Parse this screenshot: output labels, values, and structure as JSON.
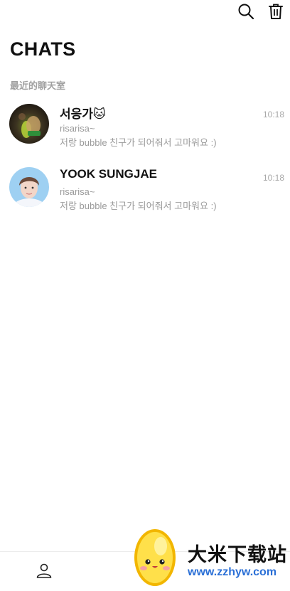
{
  "header": {
    "title": "CHATS",
    "section_label": "最近的聊天室",
    "icons": [
      "search-icon",
      "trash-icon"
    ]
  },
  "chats": [
    {
      "name": "서응가",
      "emoji": "🐱",
      "time": "10:18",
      "sender": "risarisa~",
      "preview": "저랑 bubble 친구가 되어줘서 고마워요 :)"
    },
    {
      "name": "YOOK SUNGJAE",
      "emoji": "",
      "time": "10:18",
      "sender": "risarisa~",
      "preview": "저랑 bubble 친구가 되어줘서 고마워요 :)"
    }
  ],
  "bottom_nav": {
    "icons": [
      "profile-icon"
    ]
  },
  "watermark": {
    "title": "大米下载站",
    "url": "www.zzhyw.com"
  },
  "colors": {
    "text_primary": "#111111",
    "text_secondary": "#9a9a9a",
    "timestamp": "#a8a8a8",
    "section_label": "#a0a0a0",
    "divider": "#ececec",
    "url_blue": "#2a6fd6"
  }
}
